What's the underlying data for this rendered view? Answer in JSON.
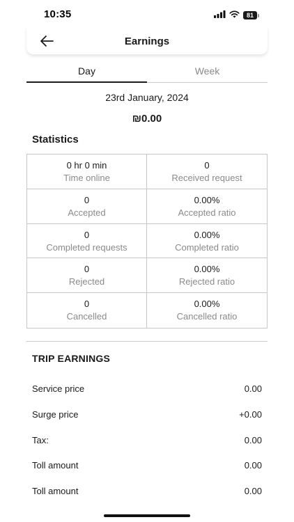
{
  "status_bar": {
    "time": "10:35",
    "battery": "81"
  },
  "header": {
    "title": "Earnings"
  },
  "tabs": [
    {
      "label": "Day",
      "active": true
    },
    {
      "label": "Week",
      "active": false
    }
  ],
  "date": "23rd January, 2024",
  "total": "₪0.00",
  "statistics": {
    "title": "Statistics",
    "cells": [
      {
        "value": "0 hr 0 min",
        "label": "Time online"
      },
      {
        "value": "0",
        "label": "Received request"
      },
      {
        "value": "0",
        "label": "Accepted"
      },
      {
        "value": "0.00%",
        "label": "Accepted ratio"
      },
      {
        "value": "0",
        "label": "Completed requests"
      },
      {
        "value": "0.00%",
        "label": "Completed ratio"
      },
      {
        "value": "0",
        "label": "Rejected"
      },
      {
        "value": "0.00%",
        "label": "Rejected ratio"
      },
      {
        "value": "0",
        "label": "Cancelled"
      },
      {
        "value": "0.00%",
        "label": "Cancelled ratio"
      }
    ]
  },
  "trip_earnings": {
    "title": "TRIP EARNINGS",
    "rows": [
      {
        "label": "Service price",
        "value": "0.00"
      },
      {
        "label": "Surge price",
        "value": "+0.00"
      },
      {
        "label": "Tax:",
        "value": "0.00"
      },
      {
        "label": "Toll amount",
        "value": "0.00"
      },
      {
        "label": "Toll amount",
        "value": "0.00"
      }
    ]
  },
  "icons": {
    "back": "arrow-left-icon",
    "signal": "cellular-signal-icon",
    "wifi": "wifi-icon",
    "battery": "battery-icon"
  },
  "colors": {
    "text": "#1a1a1a",
    "muted": "#8a8a8a",
    "border": "#c6c6c6",
    "background": "#ffffff"
  }
}
